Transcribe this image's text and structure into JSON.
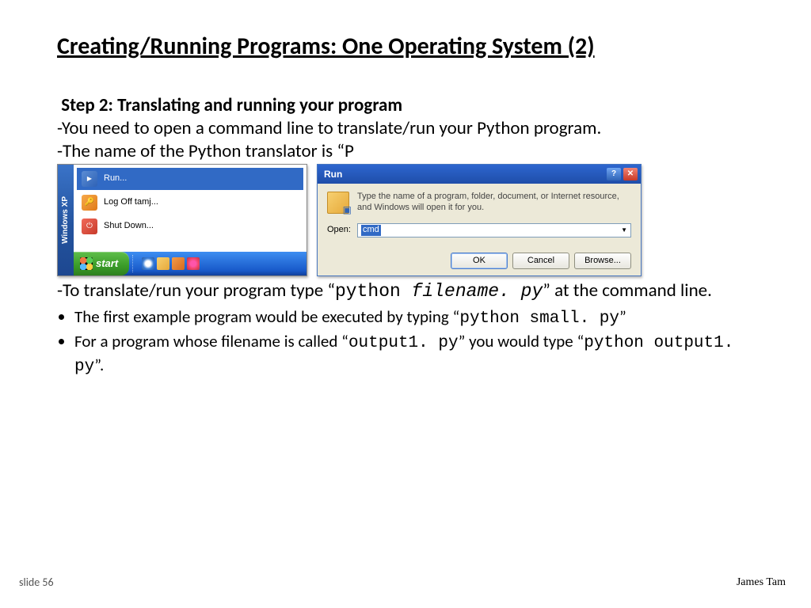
{
  "title": "Creating/Running Programs: One Operating System (2)",
  "step_heading": "Step 2: Translating and running your program",
  "para1": "-You need to open a command line to translate/run your Python program.",
  "para2_a": "-The name of the Python translator is “P",
  "run_cmd": "python ",
  "run_file": "filename. py",
  "translate_lead": "-To translate/run your program type “",
  "translate_tail": "” at the command line.",
  "bullet1_a": "The first example program would be executed by typing “",
  "bullet1_b": "python small. py",
  "bullet1_c": "”",
  "bullet2_a": "For a program whose filename is called “",
  "bullet2_b": "output1. py",
  "bullet2_c": "” you would type “",
  "bullet2_d": "python output1. py",
  "bullet2_e": "”.",
  "start_menu": {
    "brand": "Windows XP",
    "items": [
      "Run...",
      "Log Off tamj...",
      "Shut Down..."
    ],
    "start_label": "start"
  },
  "run_dialog": {
    "title": "Run",
    "hint": "Type the name of a program, folder, document, or Internet resource, and Windows will open it for you.",
    "open_label": "Open:",
    "input_value": "cmd",
    "ok": "OK",
    "cancel": "Cancel",
    "browse": "Browse..."
  },
  "footer": {
    "slide": "slide 56",
    "author": "James Tam"
  }
}
